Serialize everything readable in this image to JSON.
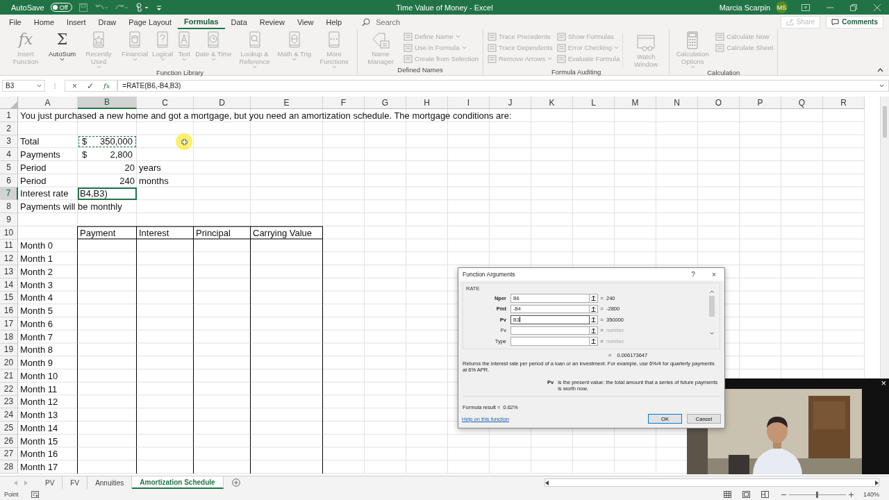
{
  "title_bar": {
    "autosave_label": "AutoSave",
    "autosave": {
      "label": "Off",
      "on": false
    },
    "document_title": "Time Value of Money  -  Excel",
    "user_name": "Marcia Scarpin",
    "user_initials": "MS"
  },
  "ribbon": {
    "tabs": [
      {
        "label": "File",
        "selected": false
      },
      {
        "label": "Home",
        "selected": false
      },
      {
        "label": "Insert",
        "selected": false
      },
      {
        "label": "Draw",
        "selected": false
      },
      {
        "label": "Page Layout",
        "selected": false
      },
      {
        "label": "Formulas",
        "selected": true
      },
      {
        "label": "Data",
        "selected": false
      },
      {
        "label": "Review",
        "selected": false
      },
      {
        "label": "View",
        "selected": false
      },
      {
        "label": "Help",
        "selected": false
      }
    ],
    "search": {
      "placeholder": "Search"
    },
    "share": {
      "label": "Share",
      "disabled": true
    },
    "comments": {
      "label": "Comments",
      "disabled": false
    },
    "groups": [
      {
        "label": "Function Library",
        "commands": [
          {
            "kind": "large",
            "label": "Insert Function",
            "glyph": "fx",
            "disabled": true,
            "dropdown": false
          },
          {
            "kind": "large",
            "label": "AutoSum",
            "glyph": "Σ",
            "disabled": false,
            "dropdown": true
          },
          {
            "kind": "large",
            "label": "Recently Used",
            "disabled": true,
            "dropdown": true
          },
          {
            "kind": "large",
            "label": "Financial",
            "disabled": true,
            "dropdown": true
          },
          {
            "kind": "large",
            "label": "Logical",
            "disabled": true,
            "dropdown": true
          },
          {
            "kind": "large",
            "label": "Text",
            "disabled": true,
            "dropdown": true
          },
          {
            "kind": "large",
            "label": "Date & Time",
            "disabled": true,
            "dropdown": true
          },
          {
            "kind": "large",
            "label": "Lookup & Reference",
            "disabled": true,
            "dropdown": true
          },
          {
            "kind": "large",
            "label": "Math & Trig",
            "disabled": true,
            "dropdown": true
          },
          {
            "kind": "large",
            "label": "More Functions",
            "disabled": true,
            "dropdown": true
          }
        ]
      },
      {
        "label": "Defined Names",
        "commands": [
          {
            "kind": "large",
            "label": "Name Manager",
            "disabled": true,
            "dropdown": false
          },
          {
            "kind": "small",
            "label": "Define Name",
            "disabled": true,
            "dropdown": true
          },
          {
            "kind": "small",
            "label": "Use in Formula",
            "disabled": true,
            "dropdown": true
          },
          {
            "kind": "small",
            "label": "Create from Selection",
            "disabled": true,
            "dropdown": false
          }
        ]
      },
      {
        "label": "Formula Auditing",
        "commands": [
          {
            "kind": "small",
            "label": "Trace Precedents",
            "disabled": true,
            "dropdown": false
          },
          {
            "kind": "small",
            "label": "Trace Dependents",
            "disabled": true,
            "dropdown": false
          },
          {
            "kind": "small",
            "label": "Remove Arrows",
            "disabled": true,
            "dropdown": true
          },
          {
            "kind": "small",
            "label": "Show Formulas",
            "disabled": true,
            "dropdown": false
          },
          {
            "kind": "small",
            "label": "Error Checking",
            "disabled": true,
            "dropdown": true
          },
          {
            "kind": "small",
            "label": "Evaluate Formula",
            "disabled": true,
            "dropdown": false
          },
          {
            "kind": "large",
            "label": "Watch Window",
            "disabled": true,
            "dropdown": false
          }
        ]
      },
      {
        "label": "Calculation",
        "commands": [
          {
            "kind": "large",
            "label": "Calculation Options",
            "disabled": true,
            "dropdown": true
          },
          {
            "kind": "small",
            "label": "Calculate Now",
            "disabled": true,
            "dropdown": false
          },
          {
            "kind": "small",
            "label": "Calculate Sheet",
            "disabled": true,
            "dropdown": false
          }
        ]
      }
    ]
  },
  "formula_bar": {
    "name_box": "B3",
    "cancel": "×",
    "enter": "✓",
    "function_glyph": "fx",
    "formula": "=RATE(B6,-B4,B3)"
  },
  "sheet": {
    "columns": [
      {
        "label": "A",
        "selected": false
      },
      {
        "label": "B",
        "selected": true
      },
      {
        "label": "C",
        "selected": false
      },
      {
        "label": "D",
        "selected": false
      },
      {
        "label": "E",
        "selected": false
      },
      {
        "label": "F",
        "selected": false
      },
      {
        "label": "G",
        "selected": false
      },
      {
        "label": "H",
        "selected": false
      },
      {
        "label": "I",
        "selected": false
      },
      {
        "label": "J",
        "selected": false
      },
      {
        "label": "K",
        "selected": false
      },
      {
        "label": "L",
        "selected": false
      },
      {
        "label": "M",
        "selected": false
      },
      {
        "label": "N",
        "selected": false
      },
      {
        "label": "O",
        "selected": false
      },
      {
        "label": "P",
        "selected": false
      },
      {
        "label": "Q",
        "selected": false
      },
      {
        "label": "R",
        "selected": false
      }
    ],
    "rows": [
      {
        "number": "1",
        "selected": false,
        "kind": "plain",
        "cells": [
          {
            "kind": "text",
            "text": "You just purchased a new home and got a mortgage, but you need an amortization schedule. The mortgage conditions are:",
            "referenced": false,
            "editing": false
          }
        ]
      },
      {
        "number": "2",
        "selected": false,
        "kind": "plain",
        "cells": []
      },
      {
        "number": "3",
        "selected": false,
        "kind": "plain",
        "cells": [
          {
            "kind": "text",
            "text": "Total",
            "referenced": false,
            "editing": false
          },
          {
            "kind": "currency",
            "symbol": "$",
            "text": "350,000",
            "referenced": true,
            "editing": false
          }
        ]
      },
      {
        "number": "4",
        "selected": false,
        "kind": "plain",
        "cells": [
          {
            "kind": "text",
            "text": "Payments",
            "referenced": false,
            "editing": false
          },
          {
            "kind": "currency",
            "symbol": "$",
            "text": "2,800",
            "referenced": false,
            "editing": false
          }
        ]
      },
      {
        "number": "5",
        "selected": false,
        "kind": "plain",
        "cells": [
          {
            "kind": "text",
            "text": "Period",
            "referenced": false,
            "editing": false
          },
          {
            "kind": "number",
            "text": "20",
            "referenced": false,
            "editing": false
          },
          {
            "kind": "text",
            "text": "years",
            "referenced": false,
            "editing": false
          }
        ]
      },
      {
        "number": "6",
        "selected": false,
        "kind": "plain",
        "cells": [
          {
            "kind": "text",
            "text": "Period",
            "referenced": false,
            "editing": false
          },
          {
            "kind": "number",
            "text": "240",
            "referenced": false,
            "editing": false
          },
          {
            "kind": "text",
            "text": "months",
            "referenced": false,
            "editing": false
          }
        ]
      },
      {
        "number": "7",
        "selected": true,
        "kind": "plain",
        "cells": [
          {
            "kind": "text",
            "text": "Interest rate",
            "referenced": false,
            "editing": false
          },
          {
            "kind": "text",
            "text": "B4,B3)",
            "referenced": false,
            "editing": true
          }
        ]
      },
      {
        "number": "8",
        "selected": false,
        "kind": "plain",
        "cells": [
          {
            "kind": "text",
            "text": "Payments will be monthly",
            "referenced": false,
            "editing": false
          }
        ]
      },
      {
        "number": "9",
        "selected": false,
        "kind": "plain",
        "cells": []
      },
      {
        "number": "10",
        "selected": false,
        "kind": "table-header",
        "cells": [
          "",
          {
            "kind": "text",
            "text": "Payment",
            "referenced": false,
            "editing": false
          },
          {
            "kind": "text",
            "text": "Interest",
            "referenced": false,
            "editing": false
          },
          {
            "kind": "text",
            "text": "Principal",
            "referenced": false,
            "editing": false
          },
          {
            "kind": "text",
            "text": "Carrying Value",
            "referenced": false,
            "editing": false
          }
        ]
      },
      {
        "number": "11",
        "selected": false,
        "kind": "table-body",
        "cells": [
          {
            "kind": "text",
            "text": "Month 0",
            "referenced": false,
            "editing": false
          }
        ]
      },
      {
        "number": "12",
        "selected": false,
        "kind": "table-body",
        "cells": [
          {
            "kind": "text",
            "text": "Month 1",
            "referenced": false,
            "editing": false
          }
        ]
      },
      {
        "number": "13",
        "selected": false,
        "kind": "table-body",
        "cells": [
          {
            "kind": "text",
            "text": "Month 2",
            "referenced": false,
            "editing": false
          }
        ]
      },
      {
        "number": "14",
        "selected": false,
        "kind": "table-body",
        "cells": [
          {
            "kind": "text",
            "text": "Month 3",
            "referenced": false,
            "editing": false
          }
        ]
      },
      {
        "number": "15",
        "selected": false,
        "kind": "table-body",
        "cells": [
          {
            "kind": "text",
            "text": "Month 4",
            "referenced": false,
            "editing": false
          }
        ]
      },
      {
        "number": "16",
        "selected": false,
        "kind": "table-body",
        "cells": [
          {
            "kind": "text",
            "text": "Month 5",
            "referenced": false,
            "editing": false
          }
        ]
      },
      {
        "number": "17",
        "selected": false,
        "kind": "table-body",
        "cells": [
          {
            "kind": "text",
            "text": "Month 6",
            "referenced": false,
            "editing": false
          }
        ]
      },
      {
        "number": "18",
        "selected": false,
        "kind": "table-body",
        "cells": [
          {
            "kind": "text",
            "text": "Month 7",
            "referenced": false,
            "editing": false
          }
        ]
      },
      {
        "number": "19",
        "selected": false,
        "kind": "table-body",
        "cells": [
          {
            "kind": "text",
            "text": "Month 8",
            "referenced": false,
            "editing": false
          }
        ]
      },
      {
        "number": "20",
        "selected": false,
        "kind": "table-body",
        "cells": [
          {
            "kind": "text",
            "text": "Month 9",
            "referenced": false,
            "editing": false
          }
        ]
      },
      {
        "number": "21",
        "selected": false,
        "kind": "table-body",
        "cells": [
          {
            "kind": "text",
            "text": "Month 10",
            "referenced": false,
            "editing": false
          }
        ]
      },
      {
        "number": "22",
        "selected": false,
        "kind": "table-body",
        "cells": [
          {
            "kind": "text",
            "text": "Month 11",
            "referenced": false,
            "editing": false
          }
        ]
      },
      {
        "number": "23",
        "selected": false,
        "kind": "table-body",
        "cells": [
          {
            "kind": "text",
            "text": "Month 12",
            "referenced": false,
            "editing": false
          }
        ]
      },
      {
        "number": "24",
        "selected": false,
        "kind": "table-body",
        "cells": [
          {
            "kind": "text",
            "text": "Month 13",
            "referenced": false,
            "editing": false
          }
        ]
      },
      {
        "number": "25",
        "selected": false,
        "kind": "table-body",
        "cells": [
          {
            "kind": "text",
            "text": "Month 14",
            "referenced": false,
            "editing": false
          }
        ]
      },
      {
        "number": "26",
        "selected": false,
        "kind": "table-body",
        "cells": [
          {
            "kind": "text",
            "text": "Month 15",
            "referenced": false,
            "editing": false
          }
        ]
      },
      {
        "number": "27",
        "selected": false,
        "kind": "table-body",
        "cells": [
          {
            "kind": "text",
            "text": "Month 16",
            "referenced": false,
            "editing": false
          }
        ]
      },
      {
        "number": "28",
        "selected": false,
        "kind": "table-body",
        "cells": [
          {
            "kind": "text",
            "text": "Month 17",
            "referenced": false,
            "editing": false
          }
        ]
      }
    ]
  },
  "sheet_tabs": {
    "tabs": [
      {
        "label": "PV",
        "selected": false
      },
      {
        "label": "FV",
        "selected": false
      },
      {
        "label": "Annuities",
        "selected": false
      },
      {
        "label": "Amortization Schedule",
        "selected": true
      }
    ]
  },
  "status_bar": {
    "mode": "Point",
    "zoom": {
      "level": 0.5,
      "label": "140%"
    }
  },
  "dialog": {
    "title": "Function Arguments",
    "help": "?",
    "close": "×",
    "function_name": "RATE",
    "arguments": [
      {
        "name": "Nper",
        "required": true,
        "value": "B6",
        "focused": false,
        "equals": "=",
        "result": "240",
        "hint": false
      },
      {
        "name": "Pmt",
        "required": true,
        "value": "-B4",
        "focused": false,
        "equals": "=",
        "result": "-2800",
        "hint": false
      },
      {
        "name": "Pv",
        "required": true,
        "value": "B3",
        "focused": true,
        "equals": "=",
        "result": "350000",
        "hint": false
      },
      {
        "name": "Fv",
        "required": false,
        "focused": false,
        "equals": "=",
        "result": "number",
        "hint": true
      },
      {
        "name": "Type",
        "required": false,
        "focused": false,
        "equals": "=",
        "result": "number",
        "hint": true
      }
    ],
    "result": {
      "equals": "=",
      "value": "0.006173647"
    },
    "description": "Returns the interest rate per period of a loan or an investment. For example, use 6%/4 for quarterly payments at 6% APR.",
    "argument_help": {
      "name": "Pv",
      "text": "is the present value: the total amount that a series of future payments is worth now."
    },
    "formula_result": {
      "label": "Formula result =",
      "value": "0.62%"
    },
    "help_link": "Help on this function",
    "buttons": [
      {
        "label": "OK",
        "default": true
      },
      {
        "label": "Cancel",
        "default": false
      }
    ]
  },
  "video_overlay": {
    "kind": "picture",
    "close": "×"
  }
}
